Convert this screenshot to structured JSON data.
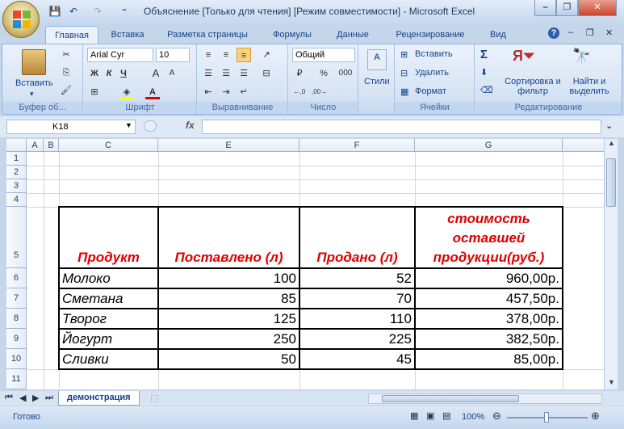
{
  "window": {
    "title": "Объяснение  [Только для чтения]  [Режим совместимости] - Microsoft Excel",
    "minimize": "–",
    "restore": "❐",
    "close": "✕"
  },
  "qat": {
    "save": "💾",
    "undo": "↶",
    "redo": "↷",
    "customize": "⁼"
  },
  "tabs": [
    "Главная",
    "Вставка",
    "Разметка страницы",
    "Формулы",
    "Данные",
    "Рецензирование",
    "Вид"
  ],
  "ribbon": {
    "clipboard": {
      "paste": "Вставить",
      "label": "Буфер об..."
    },
    "font": {
      "name": "Arial Cyr",
      "size": "10",
      "bold": "Ж",
      "italic": "К",
      "underline": "Ч",
      "grow": "A",
      "shrink": "A",
      "color_letter": "A",
      "label": "Шрифт"
    },
    "alignment": {
      "label": "Выравнивание"
    },
    "number": {
      "format": "Общий",
      "percent": "%",
      "thousands": "000",
      "label": "Число"
    },
    "styles": {
      "label": "Стили"
    },
    "cells": {
      "insert": "Вставить",
      "delete": "Удалить",
      "format": "Формат",
      "label": "Ячейки"
    },
    "editing": {
      "sum": "Σ",
      "sort": "Сортировка и фильтр",
      "find": "Найти и выделить",
      "label": "Редактирование"
    }
  },
  "formula_bar": {
    "name_box": "K18",
    "fx": "fx",
    "formula": ""
  },
  "columns": [
    "A",
    "B",
    "C",
    "E",
    "F",
    "G"
  ],
  "rows": [
    "1",
    "2",
    "3",
    "4",
    "5",
    "6",
    "7",
    "8",
    "9",
    "10",
    "11"
  ],
  "table": {
    "headers": [
      "Продукт",
      "Поставлено (л)",
      "Продано (л)",
      "стоимость оставшей продукции(руб.)"
    ],
    "rows": [
      [
        "Молоко",
        "100",
        "52",
        "960,00р."
      ],
      [
        "Сметана",
        "85",
        "70",
        "457,50р."
      ],
      [
        "Творог",
        "125",
        "110",
        "378,00р."
      ],
      [
        "Йогурт",
        "250",
        "225",
        "382,50р."
      ],
      [
        "Сливки",
        "50",
        "45",
        "85,00р."
      ]
    ]
  },
  "sheet_tabs": {
    "active": "демонстрация"
  },
  "status": {
    "ready": "Готово",
    "zoom": "100%"
  },
  "colors": {
    "header_text": "#e00000",
    "ribbon": "#d7e4f4",
    "accent": "#15428b"
  }
}
